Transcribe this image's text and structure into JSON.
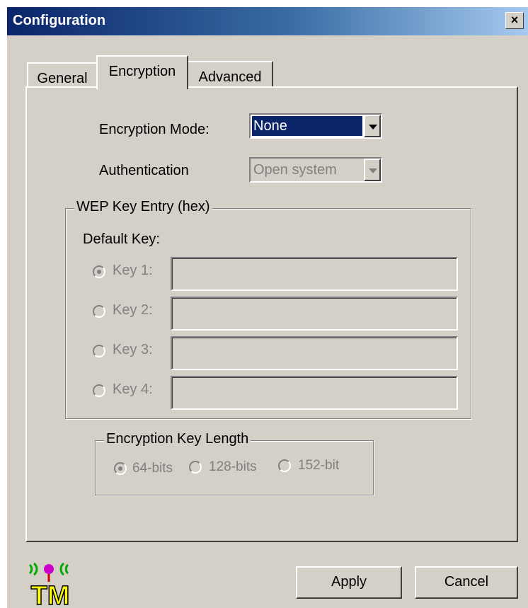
{
  "window": {
    "title": "Configuration",
    "close_label": "×"
  },
  "tabs": [
    {
      "label": "General"
    },
    {
      "label": "Encryption"
    },
    {
      "label": "Advanced"
    }
  ],
  "encryption_mode": {
    "label": "Encryption Mode:",
    "value": "None"
  },
  "authentication": {
    "label": "Authentication",
    "value": "Open system"
  },
  "wep_group": {
    "legend": "WEP Key Entry (hex)",
    "default_key_label": "Default Key:",
    "keys": [
      {
        "label": "Key 1:",
        "selected": true
      },
      {
        "label": "Key 2:",
        "selected": false
      },
      {
        "label": "Key 3:",
        "selected": false
      },
      {
        "label": "Key 4:",
        "selected": false
      }
    ]
  },
  "key_length_group": {
    "legend": "Encryption Key Length",
    "options": [
      {
        "label": "64-bits",
        "selected": true
      },
      {
        "label": "128-bits",
        "selected": false
      },
      {
        "label": "152-bit",
        "selected": false
      }
    ]
  },
  "logo": {
    "text": "TM"
  },
  "buttons": {
    "apply": "Apply",
    "cancel": "Cancel"
  },
  "colors": {
    "title_start": "#0a246a",
    "title_end": "#a6caf0",
    "dialog_bg": "#d4d0c8",
    "selection": "#0a246a",
    "disabled_text": "#808080"
  }
}
